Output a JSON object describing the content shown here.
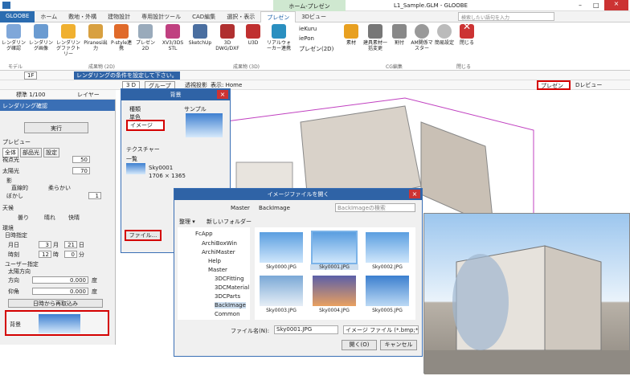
{
  "title": "L1_Sample.GLM - GLOOBE",
  "context_tab": "ホーム-プレゼン",
  "search": {
    "placeholder": "検索したい語句を入力"
  },
  "tabs": [
    "GLOOBE",
    "ホーム",
    "敷地・外構",
    "建物設計",
    "専用設計ツール",
    "CAD編集",
    "選択・表示",
    "プレゼン",
    "3Dビュー"
  ],
  "ribbon": {
    "buttons": [
      "レンダリング確認",
      "レンダリング画像",
      "レンダリングファクトリー",
      "Piranesi出力",
      "P-style連携",
      "プレゼン2D",
      "XV3/3DS STL",
      "SketchUp",
      "3D DWG/DXF",
      "U3D",
      "リアルウォーカー連携",
      "ieKuru",
      "iePon",
      "プレゼン(2D)",
      "素材",
      "建具素材一括変更",
      "割付",
      "AM関係マスター",
      "簡易設定",
      "閉じる"
    ],
    "groups": [
      "モデル",
      "成果物 (2D)",
      "成果物 (3D)",
      "CG編集",
      "閉じる"
    ]
  },
  "viewbar": {
    "floor": "1F",
    "msg": "レンダリングの条件を設定して下さい。",
    "scale": "標準 1/100",
    "layer": "レイヤー",
    "tab3d": "3 D",
    "group": "グループ",
    "persp": "透視投影",
    "viewname": "表示: Home",
    "presen": "プレゼン",
    "preview": "Dレビュー"
  },
  "panel": {
    "header": "レンダリング確認",
    "exec": "実行",
    "preview": "プレビュー",
    "tabs": [
      "全体",
      "部品光",
      "設定"
    ],
    "view_light": "視点光",
    "view_light_val": "50",
    "sun": "太陽光",
    "sun_val": "70",
    "shadow": "影",
    "direct": "直線的",
    "soft": "柔らかい",
    "blur": "ぼかし",
    "blur_val": "1",
    "weather": "天候",
    "weather_opts": [
      "曇り",
      "晴れ",
      "快晴"
    ],
    "env": "環境",
    "date_spec": "日時指定",
    "month_day": "月日",
    "month": "3",
    "day": "21",
    "month_u": "月",
    "day_u": "日",
    "time": "時刻",
    "hour": "12",
    "minute": "0",
    "hour_u": "時",
    "min_u": "分",
    "user_spec": "ユーザー指定",
    "sun_dir": "太陽方向",
    "dir": "方向",
    "dir_val": "0.000",
    "elev": "仰角",
    "elev_val": "0.000",
    "deg": "度",
    "recalc": "日時から再取込み",
    "bg": "背景"
  },
  "bg_dialog": {
    "title": "背景",
    "kind": "種類",
    "sample": "サンプル",
    "single": "単色",
    "image": "イメージ",
    "texture": "テクスチャー",
    "list": "一覧",
    "file_name": "Sky0001",
    "size": "1706 × 1365",
    "file_btn": "ファイル..."
  },
  "open_dialog": {
    "title": "イメージファイルを開く",
    "path": [
      "Master",
      "BackImage"
    ],
    "search_ph": "BackImageの検索",
    "organize": "整理 ▾",
    "new_folder": "新しいフォルダー",
    "tree": [
      "FcApp",
      "ArchiBoxWin",
      "ArchiMaster",
      "Help",
      "Master",
      "3DCFitting",
      "3DCMaterial",
      "3DCParts",
      "BackImage",
      "Common"
    ],
    "files": [
      "Sky0000.JPG",
      "Sky0001.JPG",
      "Sky0002.JPG",
      "Sky0003.JPG",
      "Sky0004.JPG",
      "Sky0005.JPG"
    ],
    "filename_label": "ファイル名(N):",
    "filename": "Sky0001.JPG",
    "filetype": "イメージ ファイル (*.bmp;*.gif;*",
    "open": "開く(O)",
    "cancel": "キャンセル"
  }
}
